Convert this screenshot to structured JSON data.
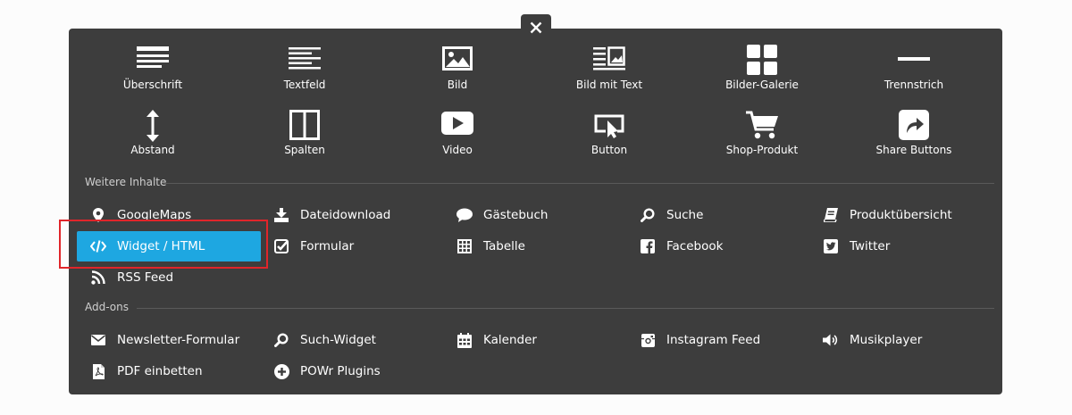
{
  "close_button": {
    "label": "✕"
  },
  "tiles": [
    {
      "label": "Überschrift",
      "icon": "heading-icon"
    },
    {
      "label": "Textfeld",
      "icon": "text-icon"
    },
    {
      "label": "Bild",
      "icon": "image-icon"
    },
    {
      "label": "Bild mit Text",
      "icon": "image-text-icon"
    },
    {
      "label": "Bilder-Galerie",
      "icon": "gallery-icon"
    },
    {
      "label": "Trennstrich",
      "icon": "divider-icon"
    },
    {
      "label": "Abstand",
      "icon": "spacing-icon"
    },
    {
      "label": "Spalten",
      "icon": "columns-icon"
    },
    {
      "label": "Video",
      "icon": "video-icon"
    },
    {
      "label": "Button",
      "icon": "button-icon"
    },
    {
      "label": "Shop-Produkt",
      "icon": "cart-icon"
    },
    {
      "label": "Share Buttons",
      "icon": "share-icon"
    }
  ],
  "sections": [
    {
      "title": "Weitere Inhalte",
      "items": [
        {
          "label": "GoogleMaps",
          "icon": "map-pin-icon"
        },
        {
          "label": "Dateidownload",
          "icon": "download-icon"
        },
        {
          "label": "Gästebuch",
          "icon": "chat-bubble-icon"
        },
        {
          "label": "Suche",
          "icon": "search-icon"
        },
        {
          "label": "Produktübersicht",
          "icon": "book-icon"
        },
        {
          "label": "Widget / HTML",
          "icon": "code-icon",
          "active": true
        },
        {
          "label": "Formular",
          "icon": "checkbox-icon"
        },
        {
          "label": "Tabelle",
          "icon": "table-icon"
        },
        {
          "label": "Facebook",
          "icon": "facebook-icon"
        },
        {
          "label": "Twitter",
          "icon": "twitter-icon"
        },
        {
          "label": "RSS Feed",
          "icon": "rss-icon"
        }
      ]
    },
    {
      "title": "Add-ons",
      "items": [
        {
          "label": "Newsletter-Formular",
          "icon": "envelope-icon"
        },
        {
          "label": "Such-Widget",
          "icon": "search-icon"
        },
        {
          "label": "Kalender",
          "icon": "calendar-icon"
        },
        {
          "label": "Instagram Feed",
          "icon": "instagram-icon"
        },
        {
          "label": "Musikplayer",
          "icon": "speaker-icon"
        },
        {
          "label": "PDF einbetten",
          "icon": "pdf-icon"
        },
        {
          "label": "POWr Plugins",
          "icon": "plus-circle-icon"
        }
      ]
    }
  ],
  "colors": {
    "panel": "#3d3d3d",
    "accent": "#1ea7e1",
    "highlight": "#e0252a"
  }
}
